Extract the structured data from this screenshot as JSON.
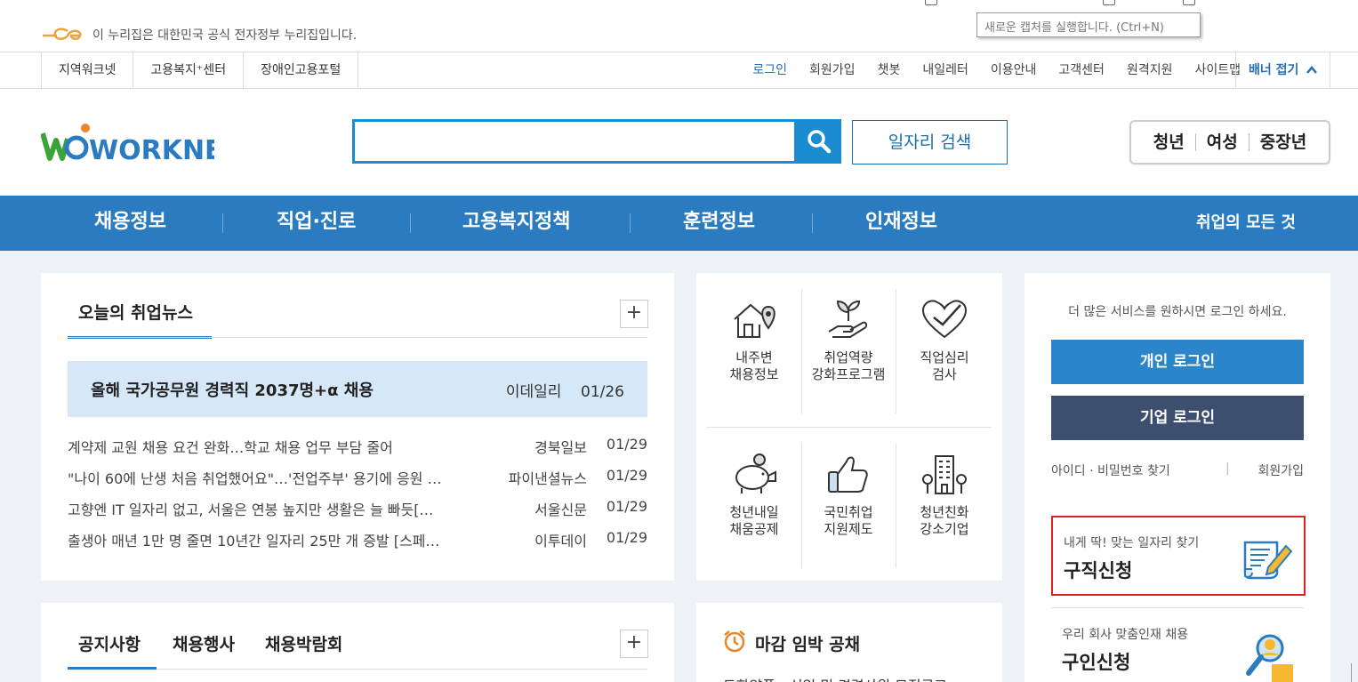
{
  "gov_banner": {
    "text": "이 누리집은 대한민국 공식 전자정부 누리집입니다."
  },
  "tooltip": {
    "text": "새로운 캡처를 실행합니다. (Ctrl+N)"
  },
  "util_bar": {
    "left_links": [
      "지역워크넷",
      "고용복지⁺센터",
      "장애인고용포털"
    ],
    "right_links": [
      "로그인",
      "회원가입",
      "챗봇",
      "내일레터",
      "이용안내",
      "고객센터",
      "원격지원",
      "사이트맵"
    ],
    "banner_toggle": "배너 접기"
  },
  "header": {
    "logo_text": "WORKNET",
    "search_placeholder": "",
    "search_button_icon": "search-icon",
    "job_search_label": "일자리 검색",
    "age_tabs": [
      "청년",
      "여성",
      "중장년"
    ]
  },
  "gnb": {
    "items": [
      "채용정보",
      "직업·진로",
      "고용복지정책",
      "훈련정보",
      "인재정보"
    ],
    "right": "취업의 모든 것"
  },
  "news": {
    "tab": "오늘의 취업뉴스",
    "headline": {
      "title": "올해 국가공무원 경력직 2037명+α 채용",
      "source": "이데일리",
      "date": "01/26"
    },
    "items": [
      {
        "title": "계약제 교원 채용 요건 완화…학교 채용 업무 부담 줄어",
        "source": "경북일보",
        "date": "01/29"
      },
      {
        "title": "\"나이 60에 난생 처음 취업했어요\"…'전업주부' 용기에 응원 …",
        "source": "파이낸셜뉴스",
        "date": "01/29"
      },
      {
        "title": "고향엔 IT 일자리 없고, 서울은 연봉 높지만 생활은 늘 빠듯[…",
        "source": "서울신문",
        "date": "01/29"
      },
      {
        "title": "출생아 매년 1만 명 줄면 10년간 일자리 25만 개 증발 [스페…",
        "source": "이투데이",
        "date": "01/29"
      }
    ]
  },
  "services": [
    {
      "line1": "내주변",
      "line2": "채용정보",
      "icon": "house-location-icon"
    },
    {
      "line1": "취업역량",
      "line2": "강화프로그램",
      "icon": "sprout-hand-icon"
    },
    {
      "line1": "직업심리",
      "line2": "검사",
      "icon": "heart-check-icon"
    },
    {
      "line1": "청년내일",
      "line2": "채움공제",
      "icon": "piggy-bank-icon"
    },
    {
      "line1": "국민취업",
      "line2": "지원제도",
      "icon": "thumbs-up-icon"
    },
    {
      "line1": "청년친화",
      "line2": "강소기업",
      "icon": "building-icon"
    }
  ],
  "login": {
    "message": "더 많은 서비스를 원하시면 로그인 하세요.",
    "personal": "개인 로그인",
    "company": "기업 로그인",
    "find": "아이디 · 비밀번호 찾기",
    "sep": "|",
    "join": "회원가입",
    "card1": {
      "sub": "내게 딱! 맞는 일자리 찾기",
      "main": "구직신청",
      "icon": "resume-pen-icon"
    },
    "card2": {
      "sub": "우리 회사 맞춤인재 채용",
      "main": "구인신청",
      "icon": "search-person-icon"
    }
  },
  "notice": {
    "tabs": [
      "공지사항",
      "채용행사",
      "채용박람회"
    ]
  },
  "deadline": {
    "title": "마감 임박 공채",
    "icon": "alarm-clock-icon",
    "first_item": "도화약품 - 신입 및 경력사원 모집공고"
  },
  "colors": {
    "brand_blue": "#2a7bbf",
    "search_blue": "#1a8ccf",
    "company_btn": "#3d4f6f",
    "highlight_red": "#e02020"
  }
}
